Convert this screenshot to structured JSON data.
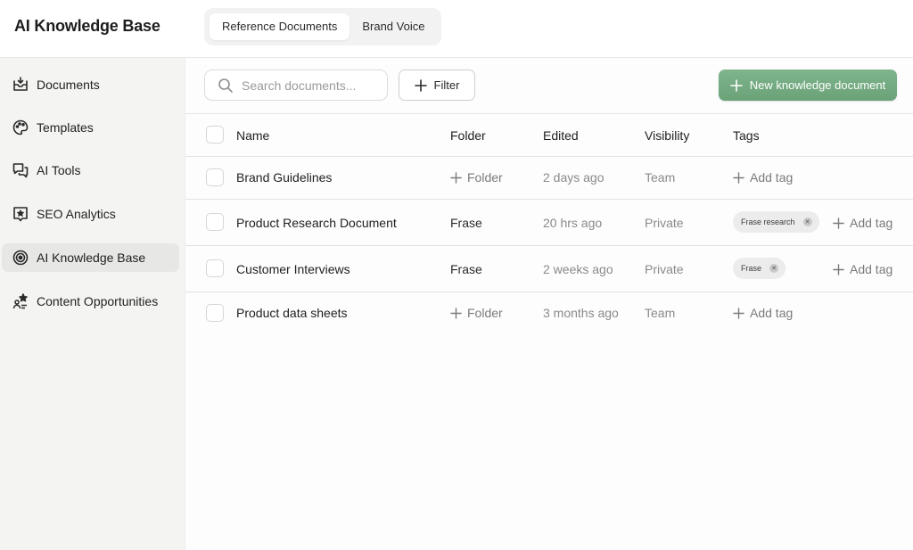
{
  "app": {
    "title": "AI Knowledge Base"
  },
  "tabs": [
    {
      "label": "Reference Documents"
    },
    {
      "label": "Brand Voice"
    }
  ],
  "sidebar": {
    "items": [
      {
        "label": "Documents",
        "icon": "inbox-icon"
      },
      {
        "label": "Templates",
        "icon": "palette-icon"
      },
      {
        "label": "AI Tools",
        "icon": "chat-bubbles-icon"
      },
      {
        "label": "SEO Analytics",
        "icon": "star-badge-icon"
      },
      {
        "label": "AI Knowledge Base",
        "icon": "target-icon",
        "active": true
      },
      {
        "label": "Content Opportunities",
        "icon": "sparkle-person-icon"
      }
    ]
  },
  "toolbar": {
    "search_placeholder": "Search documents...",
    "filter_label": "Filter",
    "new_doc_label": "New knowledge document",
    "accent_color": "#6ea97c"
  },
  "table": {
    "headers": {
      "name": "Name",
      "folder": "Folder",
      "edited": "Edited",
      "visibility": "Visibility",
      "tags": "Tags"
    },
    "rows": [
      {
        "name": "Brand Guidelines",
        "folder": "Folder",
        "edited": "2 days ago",
        "visibility": "Team",
        "tags": [],
        "add_tag": "Add tag"
      },
      {
        "name": "Product Research Document",
        "folder": "Frase",
        "edited": "20 hrs ago",
        "visibility": "Private",
        "tags": [
          "Frase research"
        ],
        "add_tag": "Add tag"
      },
      {
        "name": "Customer Interviews",
        "folder": "Frase",
        "edited": "2 weeks ago",
        "visibility": "Private",
        "tags": [
          "Frase"
        ],
        "add_tag": "Add tag"
      },
      {
        "name": "Product data sheets",
        "folder": "Folder",
        "edited": "3 months ago",
        "visibility": "Team",
        "tags": [],
        "add_tag": "Add tag"
      }
    ]
  }
}
